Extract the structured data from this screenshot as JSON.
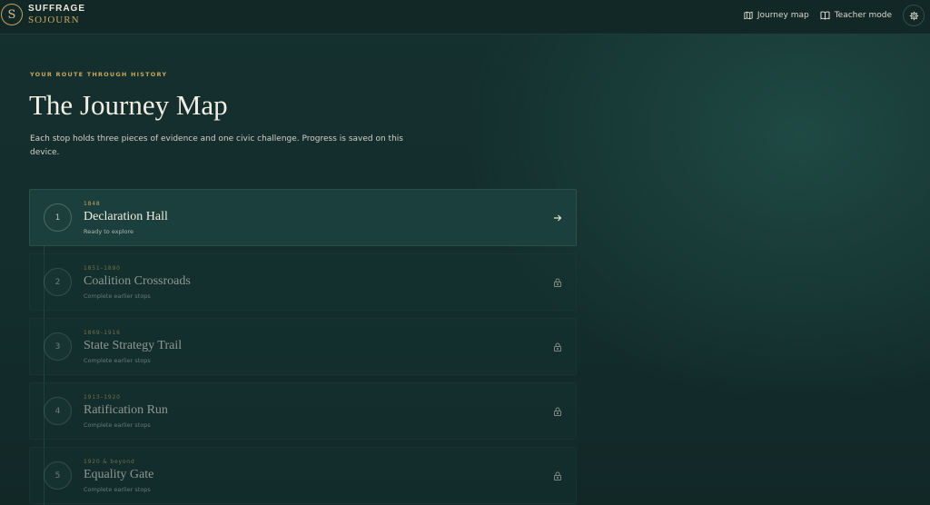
{
  "brand": {
    "monogram": "S",
    "line1": "SUFFRAGE",
    "line2": "SOJOURN"
  },
  "nav": {
    "journey_map": "Journey map",
    "teacher_mode": "Teacher mode"
  },
  "page": {
    "eyebrow": "YOUR ROUTE THROUGH HISTORY",
    "title": "The Journey Map",
    "intro": "Each stop holds three pieces of evidence and one civic challenge. Progress is saved on this device."
  },
  "stops": [
    {
      "number": "1",
      "year": "1848",
      "name": "Declaration Hall",
      "status": "Ready to explore",
      "state": "unlocked",
      "icon": "arrow-right-icon"
    },
    {
      "number": "2",
      "year": "1851–1890",
      "name": "Coalition Crossroads",
      "status": "Complete earlier stops",
      "state": "locked",
      "icon": "lock-icon"
    },
    {
      "number": "3",
      "year": "1869–1916",
      "name": "State Strategy Trail",
      "status": "Complete earlier stops",
      "state": "locked",
      "icon": "lock-icon"
    },
    {
      "number": "4",
      "year": "1913–1920",
      "name": "Ratification Run",
      "status": "Complete earlier stops",
      "state": "locked",
      "icon": "lock-icon"
    },
    {
      "number": "5",
      "year": "1920 & beyond",
      "name": "Equality Gate",
      "status": "Complete earlier stops",
      "state": "locked",
      "icon": "lock-icon"
    }
  ],
  "colors": {
    "accent_gold": "#c9a55c",
    "background": "#14302f",
    "card": "#1b3f3c"
  }
}
